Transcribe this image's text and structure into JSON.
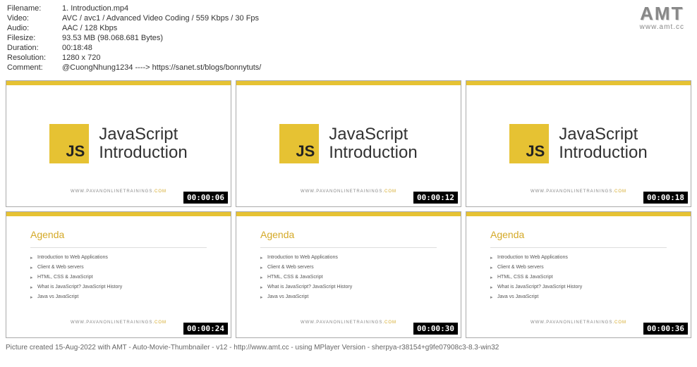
{
  "info": {
    "filename_label": "Filename:",
    "filename": "1. Introduction.mp4",
    "video_label": "Video:",
    "video": "AVC / avc1 / Advanced Video Coding / 559 Kbps / 30 Fps",
    "audio_label": "Audio:",
    "audio": "AAC / 128 Kbps",
    "filesize_label": "Filesize:",
    "filesize": "93.53 MB (98.068.681 Bytes)",
    "duration_label": "Duration:",
    "duration": "00:18:48",
    "resolution_label": "Resolution:",
    "resolution": "1280 x 720",
    "comment_label": "Comment:",
    "comment": "@CuongNhung1234 ---->  https://sanet.st/blogs/bonnytuts/"
  },
  "logo": {
    "text": "AMT",
    "url": "www.amt.cc"
  },
  "slide_intro": {
    "badge": "JS",
    "title_line1": "JavaScript",
    "title_line2": "Introduction",
    "footer": "WWW.PAVANONLINETRAININGS."
  },
  "agenda": {
    "title": "Agenda",
    "items": [
      "Introduction to Web Applications",
      "Client & Web servers",
      "HTML, CSS & JavaScript",
      "What is JavaScript? JavaScript History",
      "Java vs JavaScript"
    ]
  },
  "timestamps": [
    "00:00:06",
    "00:00:12",
    "00:00:18",
    "00:00:24",
    "00:00:30",
    "00:00:36"
  ],
  "credit": "Picture created 15-Aug-2022 with AMT - Auto-Movie-Thumbnailer - v12 - http://www.amt.cc - using MPlayer Version - sherpya-r38154+g9fe07908c3-8.3-win32"
}
